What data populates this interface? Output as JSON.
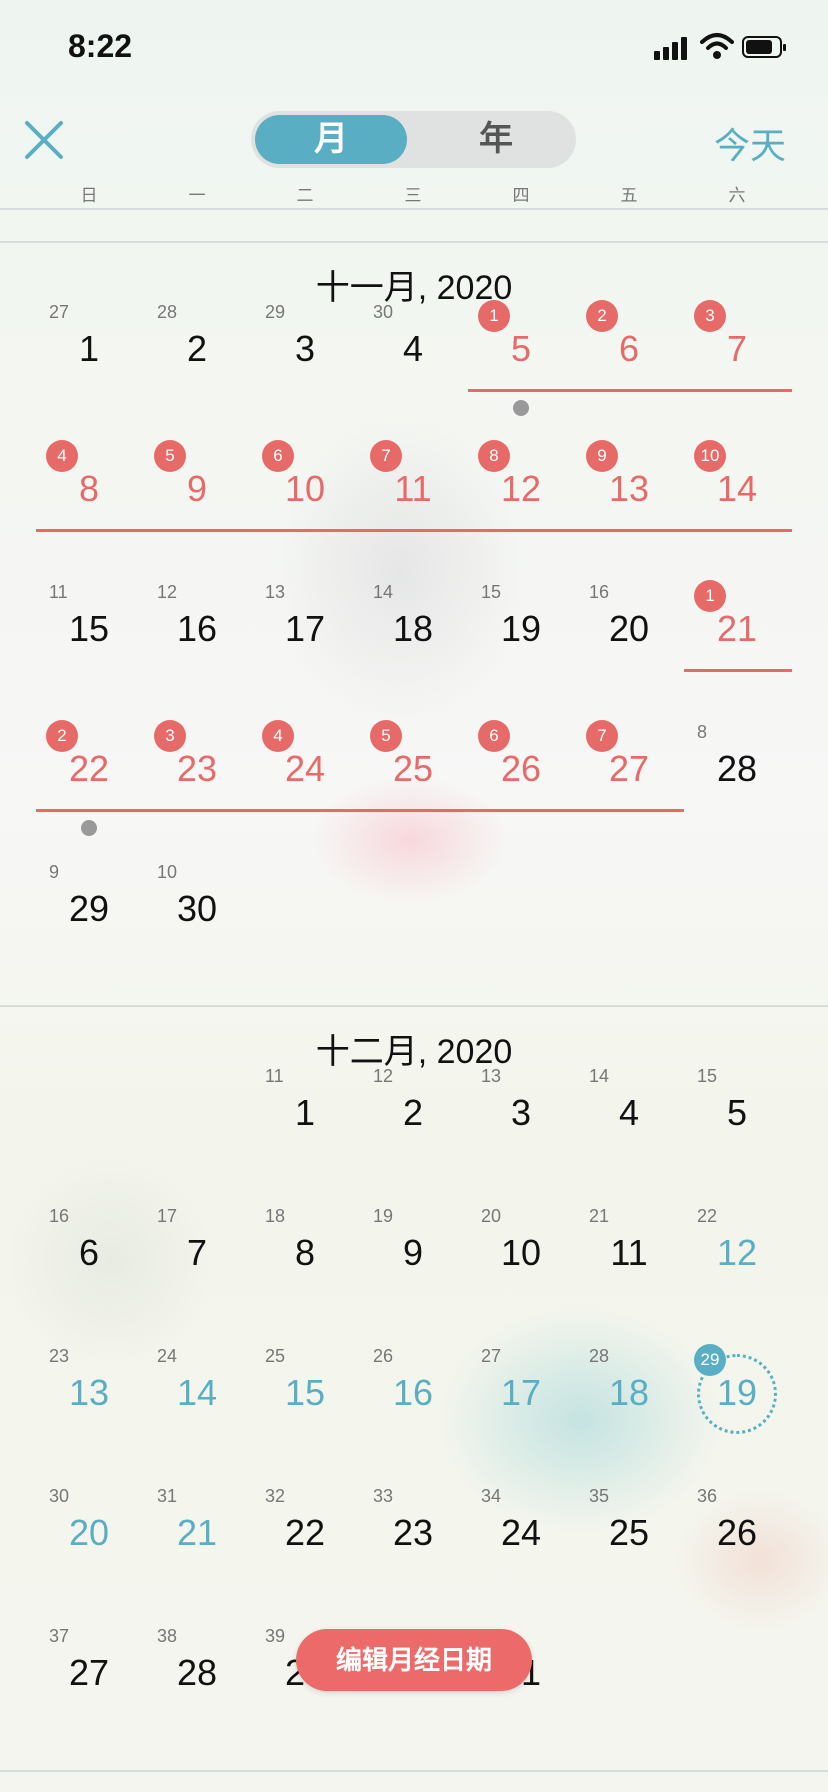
{
  "status_bar": {
    "time": "8:22"
  },
  "nav": {
    "segment_month": "月",
    "segment_year": "年",
    "today_label": "今天"
  },
  "weekdays": [
    "日",
    "一",
    "二",
    "三",
    "四",
    "五",
    "六"
  ],
  "months": [
    {
      "title": "十一月, 2020",
      "days": [
        {
          "day": "1",
          "sub": "27",
          "col": 0,
          "row": 0
        },
        {
          "day": "2",
          "sub": "28",
          "col": 1,
          "row": 0
        },
        {
          "day": "3",
          "sub": "29",
          "col": 2,
          "row": 0
        },
        {
          "day": "4",
          "sub": "30",
          "col": 3,
          "row": 0
        },
        {
          "day": "5",
          "badge": "1",
          "col": 4,
          "row": 0,
          "type": "period",
          "dot": true
        },
        {
          "day": "6",
          "badge": "2",
          "col": 5,
          "row": 0,
          "type": "period"
        },
        {
          "day": "7",
          "badge": "3",
          "col": 6,
          "row": 0,
          "type": "period"
        },
        {
          "day": "8",
          "badge": "4",
          "col": 0,
          "row": 1,
          "type": "period"
        },
        {
          "day": "9",
          "badge": "5",
          "col": 1,
          "row": 1,
          "type": "period"
        },
        {
          "day": "10",
          "badge": "6",
          "col": 2,
          "row": 1,
          "type": "period"
        },
        {
          "day": "11",
          "badge": "7",
          "col": 3,
          "row": 1,
          "type": "period"
        },
        {
          "day": "12",
          "badge": "8",
          "col": 4,
          "row": 1,
          "type": "period"
        },
        {
          "day": "13",
          "badge": "9",
          "col": 5,
          "row": 1,
          "type": "period"
        },
        {
          "day": "14",
          "badge": "10",
          "col": 6,
          "row": 1,
          "type": "period"
        },
        {
          "day": "15",
          "sub": "11",
          "col": 0,
          "row": 2
        },
        {
          "day": "16",
          "sub": "12",
          "col": 1,
          "row": 2
        },
        {
          "day": "17",
          "sub": "13",
          "col": 2,
          "row": 2
        },
        {
          "day": "18",
          "sub": "14",
          "col": 3,
          "row": 2
        },
        {
          "day": "19",
          "sub": "15",
          "col": 4,
          "row": 2
        },
        {
          "day": "20",
          "sub": "16",
          "col": 5,
          "row": 2
        },
        {
          "day": "21",
          "badge": "1",
          "col": 6,
          "row": 2,
          "type": "period"
        },
        {
          "day": "22",
          "badge": "2",
          "col": 0,
          "row": 3,
          "type": "period",
          "dot": true
        },
        {
          "day": "23",
          "badge": "3",
          "col": 1,
          "row": 3,
          "type": "period"
        },
        {
          "day": "24",
          "badge": "4",
          "col": 2,
          "row": 3,
          "type": "period"
        },
        {
          "day": "25",
          "badge": "5",
          "col": 3,
          "row": 3,
          "type": "period"
        },
        {
          "day": "26",
          "badge": "6",
          "col": 4,
          "row": 3,
          "type": "period"
        },
        {
          "day": "27",
          "badge": "7",
          "col": 5,
          "row": 3,
          "type": "period"
        },
        {
          "day": "28",
          "sub": "8",
          "col": 6,
          "row": 3
        },
        {
          "day": "29",
          "sub": "9",
          "col": 0,
          "row": 4
        },
        {
          "day": "30",
          "sub": "10",
          "col": 1,
          "row": 4
        }
      ]
    },
    {
      "title": "十二月, 2020",
      "days": [
        {
          "day": "1",
          "sub": "11",
          "col": 2,
          "row": 0
        },
        {
          "day": "2",
          "sub": "12",
          "col": 3,
          "row": 0
        },
        {
          "day": "3",
          "sub": "13",
          "col": 4,
          "row": 0
        },
        {
          "day": "4",
          "sub": "14",
          "col": 5,
          "row": 0
        },
        {
          "day": "5",
          "sub": "15",
          "col": 6,
          "row": 0
        },
        {
          "day": "6",
          "sub": "16",
          "col": 0,
          "row": 1
        },
        {
          "day": "7",
          "sub": "17",
          "col": 1,
          "row": 1
        },
        {
          "day": "8",
          "sub": "18",
          "col": 2,
          "row": 1
        },
        {
          "day": "9",
          "sub": "19",
          "col": 3,
          "row": 1
        },
        {
          "day": "10",
          "sub": "20",
          "col": 4,
          "row": 1
        },
        {
          "day": "11",
          "sub": "21",
          "col": 5,
          "row": 1
        },
        {
          "day": "12",
          "sub": "22",
          "col": 6,
          "row": 1,
          "type": "fertile"
        },
        {
          "day": "13",
          "sub": "23",
          "col": 0,
          "row": 2,
          "type": "fertile"
        },
        {
          "day": "14",
          "sub": "24",
          "col": 1,
          "row": 2,
          "type": "fertile"
        },
        {
          "day": "15",
          "sub": "25",
          "col": 2,
          "row": 2,
          "type": "fertile"
        },
        {
          "day": "16",
          "sub": "26",
          "col": 3,
          "row": 2,
          "type": "fertile"
        },
        {
          "day": "17",
          "sub": "27",
          "col": 4,
          "row": 2,
          "type": "fertile"
        },
        {
          "day": "18",
          "sub": "28",
          "col": 5,
          "row": 2,
          "type": "fertile"
        },
        {
          "day": "19",
          "badge": "29",
          "col": 6,
          "row": 2,
          "type": "fertile",
          "today": true
        },
        {
          "day": "20",
          "sub": "30",
          "col": 0,
          "row": 3,
          "type": "fertile"
        },
        {
          "day": "21",
          "sub": "31",
          "col": 1,
          "row": 3,
          "type": "fertile"
        },
        {
          "day": "22",
          "sub": "32",
          "col": 2,
          "row": 3
        },
        {
          "day": "23",
          "sub": "33",
          "col": 3,
          "row": 3
        },
        {
          "day": "24",
          "sub": "34",
          "col": 4,
          "row": 3
        },
        {
          "day": "25",
          "sub": "35",
          "col": 5,
          "row": 3
        },
        {
          "day": "26",
          "sub": "36",
          "col": 6,
          "row": 3
        },
        {
          "day": "27",
          "sub": "37",
          "col": 0,
          "row": 4
        },
        {
          "day": "28",
          "sub": "38",
          "col": 1,
          "row": 4
        },
        {
          "day": "29",
          "sub": "39",
          "col": 2,
          "row": 4
        },
        {
          "day": "31",
          "col": 4,
          "row": 4
        }
      ]
    }
  ],
  "edit_button": "编辑月经日期",
  "colors": {
    "accent": "#5aaec3",
    "period": "#e66a68",
    "text": "#111111",
    "muted": "#777777"
  }
}
